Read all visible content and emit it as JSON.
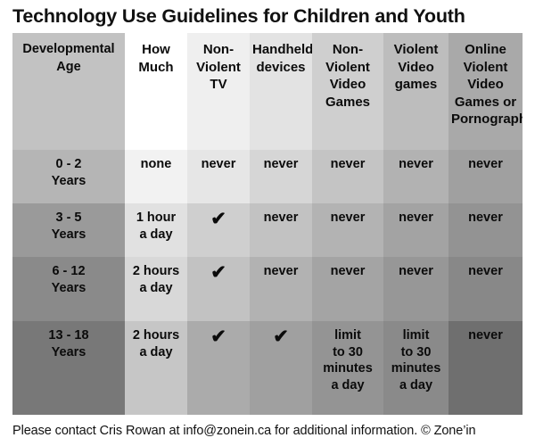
{
  "title": "Technology Use Guidelines for Children and Youth",
  "footer": "Please contact Cris Rowan at info@zonein.ca for additional information. © Zone’in",
  "table": {
    "columns": [
      "Developmental Age",
      "How Much",
      "Non-Violent TV",
      "Handheld devices",
      "Non-Violent Video Games",
      "Violent Video games",
      "Online Violent Video Games or Pornography"
    ],
    "column_lines": [
      [
        "Developmental",
        "Age"
      ],
      [
        "How",
        "Much"
      ],
      [
        "Non-",
        "Violent",
        "TV"
      ],
      [
        "Handheld",
        "devices"
      ],
      [
        "Non-",
        "Violent",
        "Video",
        "Games"
      ],
      [
        "Violent",
        "Video",
        "games"
      ],
      [
        "Online",
        "Violent",
        "Video",
        "Games or",
        "Pornography"
      ]
    ],
    "rows": [
      {
        "age_lines": [
          "0 - 2",
          "Years"
        ],
        "cells": [
          "none",
          "never",
          "never",
          "never",
          "never",
          "never"
        ],
        "cell_lines": [
          [
            "none"
          ],
          [
            "never"
          ],
          [
            "never"
          ],
          [
            "never"
          ],
          [
            "never"
          ],
          [
            "never"
          ]
        ]
      },
      {
        "age_lines": [
          "3 - 5",
          "Years"
        ],
        "cells": [
          "1 hour a day",
          "✔",
          "never",
          "never",
          "never",
          "never"
        ],
        "cell_lines": [
          [
            "1 hour",
            "a day"
          ],
          [
            "✔"
          ],
          [
            "never"
          ],
          [
            "never"
          ],
          [
            "never"
          ],
          [
            "never"
          ]
        ]
      },
      {
        "age_lines": [
          "6 - 12",
          "Years"
        ],
        "cells": [
          "2 hours a day",
          "✔",
          "never",
          "never",
          "never",
          "never"
        ],
        "cell_lines": [
          [
            "2 hours",
            "a day"
          ],
          [
            "✔"
          ],
          [
            "never"
          ],
          [
            "never"
          ],
          [
            "never"
          ],
          [
            "never"
          ]
        ]
      },
      {
        "age_lines": [
          "13 - 18",
          "Years"
        ],
        "cells": [
          "2 hours a day",
          "✔",
          "✔",
          "limit to 30 minutes a day",
          "limit to 30 minutes a day",
          "never"
        ],
        "cell_lines": [
          [
            "2 hours",
            "a day"
          ],
          [
            "✔"
          ],
          [
            "✔"
          ],
          [
            "limit",
            "to 30",
            "minutes",
            "a day"
          ],
          [
            "limit",
            "to 30",
            "minutes",
            "a day"
          ],
          [
            "never"
          ]
        ]
      }
    ],
    "colors": {
      "header": [
        "#c2c2c2",
        "#ffffff",
        "#efefef",
        "#e3e3e3",
        "#cfcfcf",
        "#bdbdbd",
        "#a9a9a9"
      ],
      "row1": [
        "#b5b5b5",
        "#f2f2f2",
        "#e6e6e6",
        "#d6d6d6",
        "#c4c4c4",
        "#b2b2b2",
        "#a0a0a0"
      ],
      "row2": [
        "#9a9a9a",
        "#e1e1e1",
        "#cfcfcf",
        "#c2c2c2",
        "#b3b3b3",
        "#a3a3a3",
        "#939393"
      ],
      "row3": [
        "#8a8a8a",
        "#d8d8d8",
        "#c2c2c2",
        "#b2b2b2",
        "#a4a4a4",
        "#979797",
        "#888888"
      ],
      "row4": [
        "#787878",
        "#c6c6c6",
        "#ababab",
        "#a0a0a0",
        "#949494",
        "#8a8a8a",
        "#6f6f6f"
      ]
    }
  }
}
